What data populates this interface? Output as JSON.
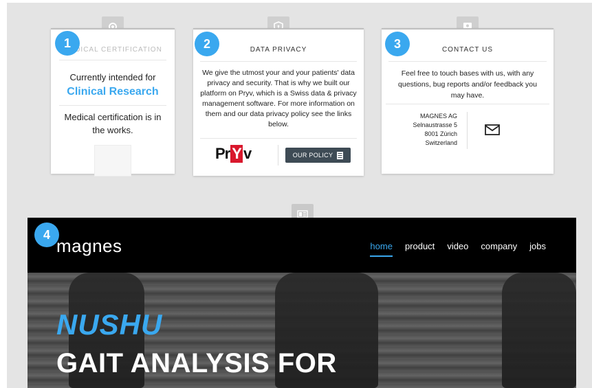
{
  "badges": [
    "1",
    "2",
    "3",
    "4"
  ],
  "colors": {
    "accent": "#3aa8ef",
    "pryv_red": "#d9182d",
    "button_dark": "#3e4b55"
  },
  "cards": {
    "medical": {
      "icon": "gear-icon",
      "title": "MEDICAL CERTIFICATION",
      "line1": "Currently intended for",
      "highlight": "Clinical Research",
      "line2": "Medical certification is in the works."
    },
    "privacy": {
      "icon": "shield-icon",
      "title": "DATA PRIVACY",
      "body": "We give the utmost your and your patients' data privacy and security. That is why we built our platform on Pryv, which is a Swiss data & privacy management software. For more information on them and our data privacy policy see the links below.",
      "logo_pre": "Pr",
      "logo_y": "Y",
      "logo_post": "v",
      "button": "OUR POLICY"
    },
    "contact": {
      "icon": "contact-card-icon",
      "title": "CONTACT US",
      "body": "Feel free to touch bases with us, with any questions, bug reports and/or feedback you may have.",
      "address": [
        "MAGNES AG",
        "Selnaustrasse 5",
        "8001 Zürich",
        "Switzerland"
      ],
      "mail_icon": "mail-icon"
    }
  },
  "site": {
    "icon": "newspaper-icon",
    "logo": "magnes",
    "nav": [
      "home",
      "product",
      "video",
      "company",
      "jobs"
    ],
    "active_nav": "home",
    "hero_title": "NUSHU",
    "hero_subtitle": "GAIT ANALYSIS FOR"
  }
}
